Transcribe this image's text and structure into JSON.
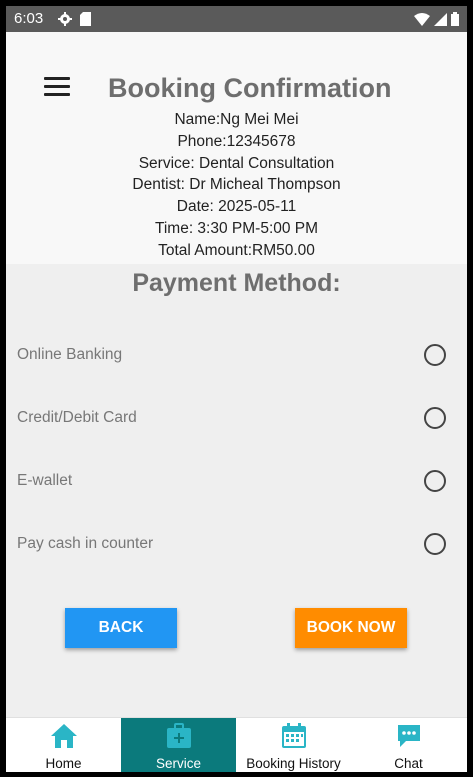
{
  "status_bar": {
    "time": "6:03"
  },
  "header": {
    "title": "Booking Confirmation",
    "details": {
      "name": "Name:Ng Mei Mei",
      "phone": "Phone:12345678",
      "service": "Service: Dental Consultation",
      "dentist": "Dentist: Dr Micheal Thompson",
      "date": "Date: 2025-05-11",
      "time": "Time: 3:30 PM-5:00 PM",
      "total": "Total Amount:RM50.00"
    }
  },
  "payment": {
    "title": "Payment Method:",
    "options": [
      {
        "label": "Online Banking",
        "selected": false
      },
      {
        "label": "Credit/Debit Card",
        "selected": false
      },
      {
        "label": "E-wallet",
        "selected": false
      },
      {
        "label": "Pay cash in counter",
        "selected": false
      }
    ]
  },
  "buttons": {
    "back": "BACK",
    "book_now": "BOOK NOW"
  },
  "bottom_nav": {
    "items": [
      {
        "label": "Home",
        "icon": "home-icon",
        "active": false
      },
      {
        "label": "Service",
        "icon": "medical-kit-icon",
        "active": true
      },
      {
        "label": "Booking History",
        "icon": "calendar-icon",
        "active": false
      },
      {
        "label": "Chat",
        "icon": "chat-icon",
        "active": false
      }
    ]
  },
  "colors": {
    "primary_button": "#2196f3",
    "book_button": "#ff8c00",
    "active_nav": "#0b7a7c",
    "nav_icon": "#2ab5c6"
  }
}
